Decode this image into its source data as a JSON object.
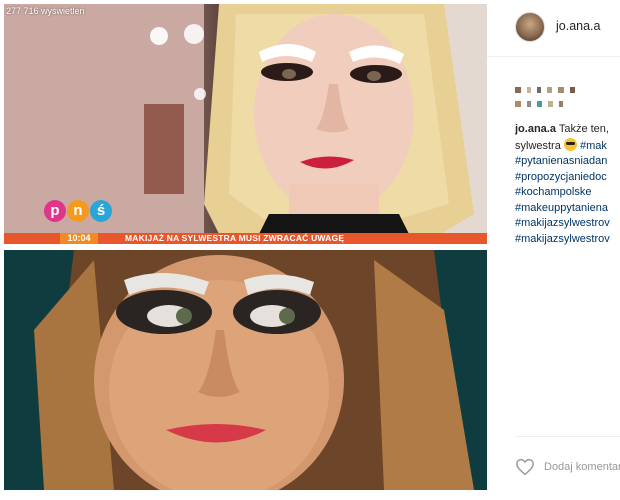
{
  "post": {
    "author": {
      "username": "jo.ana.a"
    },
    "media": {
      "top_frame": {
        "views_counter": "277 716 wyświetleń",
        "tv_logo_letters": [
          "p",
          "n",
          "ś"
        ],
        "ticker_time": "10:04",
        "ticker_text": "MAKIJAŻ NA SYLWESTRA MUSI ZWRACAĆ UWAGĘ"
      },
      "bottom_frame": {}
    },
    "caption": {
      "username": "jo.ana.a",
      "text_line1": "Także ten,",
      "text_line2": "sylwestra",
      "emoji_icon": "sunglasses-emoji-icon",
      "inline_tag": "#mak",
      "hashtags": [
        "#pytanienasniadan",
        "#propozycjaniedoc",
        "#kochampolske",
        "#makeuppytaniena",
        "#makijazsylwestrov",
        "#makijazsylwestrov"
      ]
    },
    "comment": {
      "placeholder": "Dodaj komentarz...",
      "like_icon": "heart-icon"
    }
  },
  "colors": {
    "ticker_bg": "#e8572c",
    "ticker_time_bg": "#f18a22",
    "hashtag": "#003569",
    "logo_p": "#e0368a",
    "logo_n": "#f39a1f",
    "logo_s": "#2aa5d8"
  }
}
